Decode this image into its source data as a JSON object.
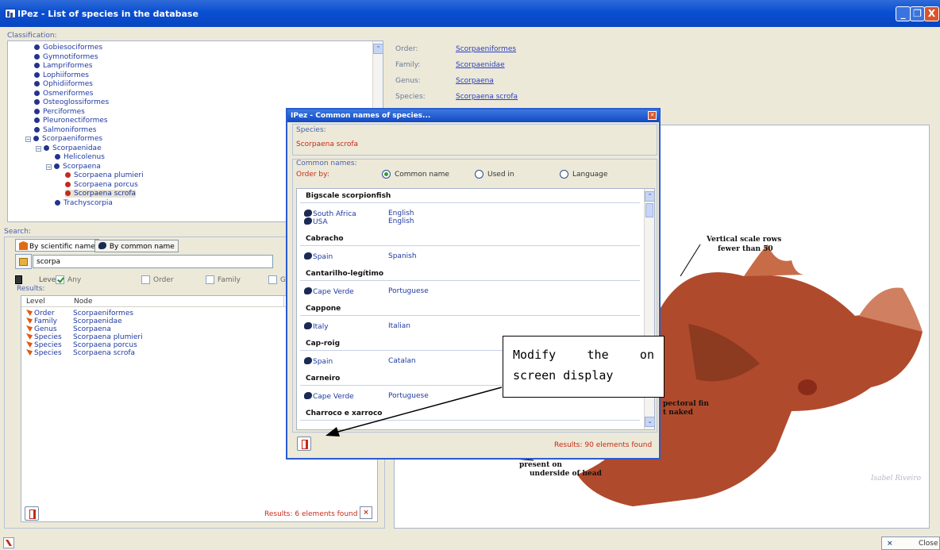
{
  "window": {
    "title": "IPez - List of species in the database",
    "min": "_",
    "max": "❐",
    "close": "X"
  },
  "classification": {
    "label": "Classification:",
    "items": [
      {
        "label": "Gobiesociformes",
        "color": "blue",
        "indent": 0
      },
      {
        "label": "Gymnotiformes",
        "color": "blue",
        "indent": 0
      },
      {
        "label": "Lampriformes",
        "color": "blue",
        "indent": 0
      },
      {
        "label": "Lophiiformes",
        "color": "blue",
        "indent": 0
      },
      {
        "label": "Ophidiiformes",
        "color": "blue",
        "indent": 0
      },
      {
        "label": "Osmeriformes",
        "color": "blue",
        "indent": 0
      },
      {
        "label": "Osteoglossiformes",
        "color": "blue",
        "indent": 0
      },
      {
        "label": "Perciformes",
        "color": "blue",
        "indent": 0
      },
      {
        "label": "Pleuronectiformes",
        "color": "blue",
        "indent": 0
      },
      {
        "label": "Salmoniformes",
        "color": "blue",
        "indent": 0
      },
      {
        "label": "Scorpaeniformes",
        "color": "blue",
        "indent": 0,
        "expander": "−"
      },
      {
        "label": "Scorpaenidae",
        "color": "blue",
        "indent": 1,
        "expander": "−"
      },
      {
        "label": "Helicolenus",
        "color": "blue",
        "indent": 2
      },
      {
        "label": "Scorpaena",
        "color": "blue",
        "indent": 2,
        "expander": "−"
      },
      {
        "label": "Scorpaena plumieri",
        "color": "red",
        "indent": 3
      },
      {
        "label": "Scorpaena porcus",
        "color": "red",
        "indent": 3
      },
      {
        "label": "Scorpaena scrofa",
        "color": "red",
        "indent": 3,
        "selected": true
      },
      {
        "label": "Trachyscorpia",
        "color": "blue",
        "indent": 2
      }
    ]
  },
  "info": {
    "order_label": "Order:",
    "order_value": "Scorpaeniformes",
    "family_label": "Family:",
    "family_value": "Scorpaenidae",
    "genus_label": "Genus:",
    "genus_value": "Scorpaena",
    "species_label": "Species:",
    "species_value": "Scorpaena scrofa"
  },
  "search": {
    "label": "Search:",
    "tab_scientific": "By scientific name",
    "tab_common": "By common name",
    "query": "scorpa",
    "level_label": "Level:",
    "levels": {
      "any": "Any",
      "order": "Order",
      "family": "Family",
      "cut": "G"
    },
    "results_label": "Results:",
    "col_level": "Level",
    "col_node": "Node",
    "rows": [
      {
        "level": "Order",
        "node": "Scorpaeniformes"
      },
      {
        "level": "Family",
        "node": "Scorpaenidae"
      },
      {
        "level": "Genus",
        "node": "Scorpaena"
      },
      {
        "level": "Species",
        "node": "Scorpaena plumieri"
      },
      {
        "level": "Species",
        "node": "Scorpaena porcus"
      },
      {
        "level": "Species",
        "node": "Scorpaena scrofa"
      }
    ],
    "results_count": "Results: 6 elements found"
  },
  "dialog": {
    "title": "IPez - Common names of species...",
    "species_label": "Species:",
    "species_value": "Scorpaena scrofa",
    "common_names_label": "Common names:",
    "order_by_label": "Order by:",
    "opt_common": "Common name",
    "opt_used": "Used in",
    "opt_lang": "Language",
    "groups": [
      {
        "name": "Bigscale scorpionfish",
        "rows": [
          {
            "country": "South Africa",
            "lang": "English"
          },
          {
            "country": "USA",
            "lang": "English"
          }
        ]
      },
      {
        "name": "Cabracho",
        "rows": [
          {
            "country": "Spain",
            "lang": "Spanish"
          }
        ]
      },
      {
        "name": "Cantarilho-legítimo",
        "rows": [
          {
            "country": "Cape Verde",
            "lang": "Portuguese"
          }
        ]
      },
      {
        "name": "Cappone",
        "rows": [
          {
            "country": "Italy",
            "lang": "Italian"
          }
        ]
      },
      {
        "name": "Cap-roig",
        "rows": [
          {
            "country": "Spain",
            "lang": "Catalan"
          }
        ]
      },
      {
        "name": "Carneiro",
        "rows": [
          {
            "country": "Cape Verde",
            "lang": "Portuguese"
          }
        ]
      },
      {
        "name": "Charroco e xarroco",
        "rows": []
      }
    ],
    "results_count": "Results: 90 elements found"
  },
  "callout": {
    "text": "Modify the on screen display"
  },
  "image_labels": {
    "vertical_scale": "Vertical scale rows",
    "fewer": "fewer than 50",
    "pectoral1": "pectoral fin",
    "pectoral2": "t naked",
    "present": "present on",
    "underside": "underside of head",
    "credit": "Isabel Riveiro"
  },
  "bottom": {
    "close": "Close"
  }
}
